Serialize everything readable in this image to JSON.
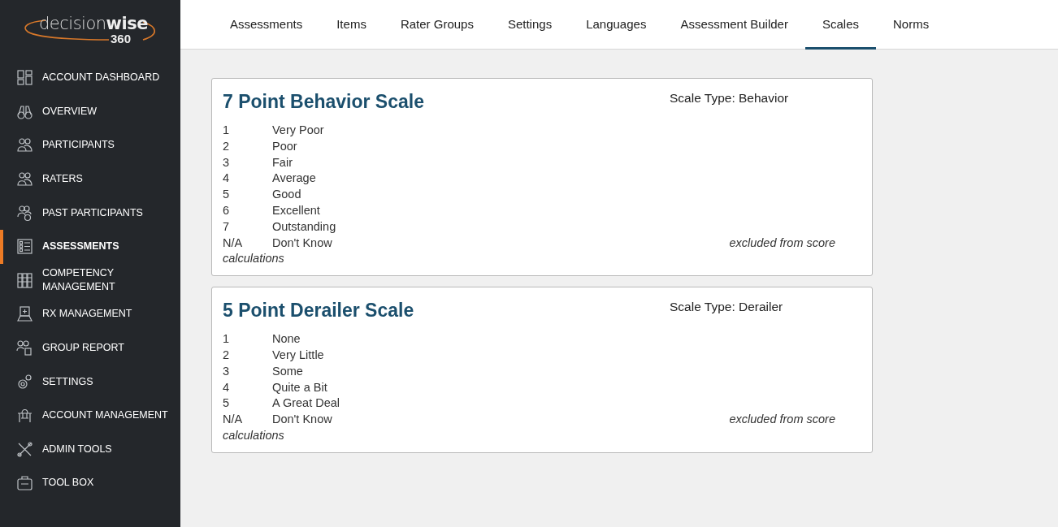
{
  "logo": {
    "word_light": "decision",
    "word_bold": "wise",
    "number": "360"
  },
  "sidebar": {
    "items": [
      {
        "label": "ACCOUNT DASHBOARD",
        "selected": false
      },
      {
        "label": "OVERVIEW",
        "selected": false
      },
      {
        "label": "PARTICIPANTS",
        "selected": false
      },
      {
        "label": "RATERS",
        "selected": false
      },
      {
        "label": "PAST PARTICIPANTS",
        "selected": false
      },
      {
        "label": "ASSESSMENTS",
        "selected": true
      },
      {
        "label": "COMPETENCY MANAGEMENT",
        "selected": false
      },
      {
        "label": "RX MANAGEMENT",
        "selected": false
      },
      {
        "label": "GROUP REPORT",
        "selected": false
      },
      {
        "label": "SETTINGS",
        "selected": false
      },
      {
        "label": "ACCOUNT MANAGEMENT",
        "selected": false
      },
      {
        "label": "ADMIN TOOLS",
        "selected": false
      },
      {
        "label": "TOOL BOX",
        "selected": false
      }
    ]
  },
  "tabs": [
    {
      "label": "Assessments",
      "selected": false
    },
    {
      "label": "Items",
      "selected": false
    },
    {
      "label": "Rater Groups",
      "selected": false
    },
    {
      "label": "Settings",
      "selected": false
    },
    {
      "label": "Languages",
      "selected": false
    },
    {
      "label": "Assessment Builder",
      "selected": false
    },
    {
      "label": "Scales",
      "selected": true
    },
    {
      "label": "Norms",
      "selected": false
    }
  ],
  "scales": [
    {
      "title": "7 Point Behavior Scale",
      "scale_type": "Scale Type: Behavior",
      "points": [
        {
          "value": "1",
          "label": "Very Poor"
        },
        {
          "value": "2",
          "label": "Poor"
        },
        {
          "value": "3",
          "label": "Fair"
        },
        {
          "value": "4",
          "label": "Average"
        },
        {
          "value": "5",
          "label": "Good"
        },
        {
          "value": "6",
          "label": "Excellent"
        },
        {
          "value": "7",
          "label": "Outstanding"
        },
        {
          "value": "N/A",
          "label": "Don't Know",
          "note_lines": [
            "excluded from score",
            "calculations"
          ]
        }
      ]
    },
    {
      "title": "5 Point Derailer Scale",
      "scale_type": "Scale Type: Derailer",
      "points": [
        {
          "value": "1",
          "label": "None"
        },
        {
          "value": "2",
          "label": "Very Little"
        },
        {
          "value": "3",
          "label": "Some"
        },
        {
          "value": "4",
          "label": "Quite a Bit"
        },
        {
          "value": "5",
          "label": "A Great Deal"
        },
        {
          "value": "N/A",
          "label": "Don't Know",
          "note_lines": [
            "excluded from score",
            "calculations"
          ]
        }
      ]
    }
  ]
}
